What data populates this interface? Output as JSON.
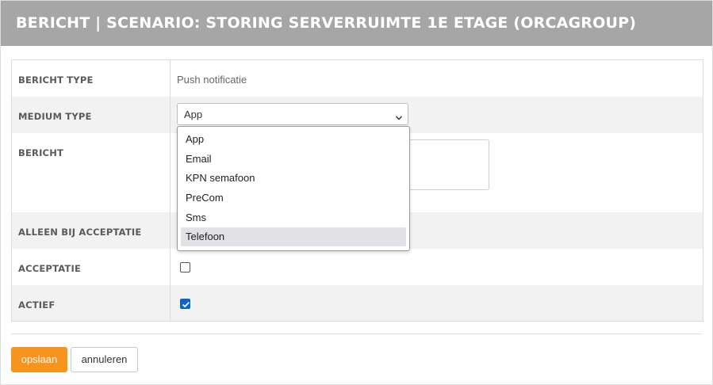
{
  "dialog": {
    "title": "BERICHT | SCENARIO: STORING SERVERRUIMTE 1E ETAGE (ORCAGROUP)"
  },
  "form": {
    "bericht_type": {
      "label": "BERICHT TYPE",
      "value": "Push notificatie"
    },
    "medium_type": {
      "label": "MEDIUM TYPE",
      "selected": "App"
    },
    "bericht": {
      "label": "BERICHT",
      "value": ""
    },
    "alleen_bij_acceptatie": {
      "label": "ALLEEN BIJ ACCEPTATIE"
    },
    "acceptatie": {
      "label": "ACCEPTATIE",
      "checked": false
    },
    "actief": {
      "label": "ACTIEF",
      "checked": true
    }
  },
  "dropdown": {
    "options": [
      "App",
      "Email",
      "KPN semafoon",
      "PreCom",
      "Sms",
      "Telefoon"
    ],
    "highlighted": "Telefoon"
  },
  "buttons": {
    "save_label": "opslaan",
    "cancel_label": "annuleren"
  },
  "colors": {
    "header_bg": "#a6a6a6",
    "accent": "#f7941d",
    "checkbox_checked": "#0b63ce"
  }
}
